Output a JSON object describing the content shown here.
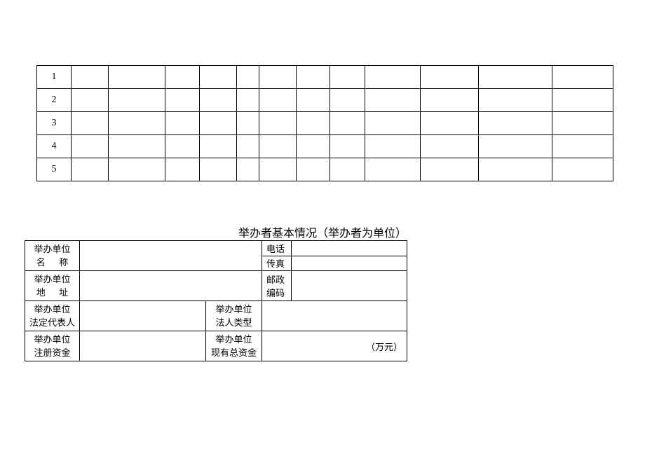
{
  "table1": {
    "rows": [
      "1",
      "2",
      "3",
      "4",
      "5"
    ]
  },
  "sectionTitle": "举办者基本情况（举办者为单位）",
  "table2": {
    "r1": {
      "label_line1": "举办单位",
      "label_line2a": "名",
      "label_line2b": "称",
      "sub1": "电话",
      "sub2": "传真"
    },
    "r2": {
      "label_line1": "举办单位",
      "label_line2a": "地",
      "label_line2b": "址",
      "sub_line1": "邮政",
      "sub_line2": "编码"
    },
    "r3": {
      "label_line1": "举办单位",
      "label_line2": "法定代表人",
      "mid_line1": "举办单位",
      "mid_line2": "法人类型"
    },
    "r4": {
      "label_line1": "举办单位",
      "label_line2": "注册资金",
      "mid_line1": "举办单位",
      "mid_line2": "现有总资金",
      "right": "（万元）"
    }
  }
}
